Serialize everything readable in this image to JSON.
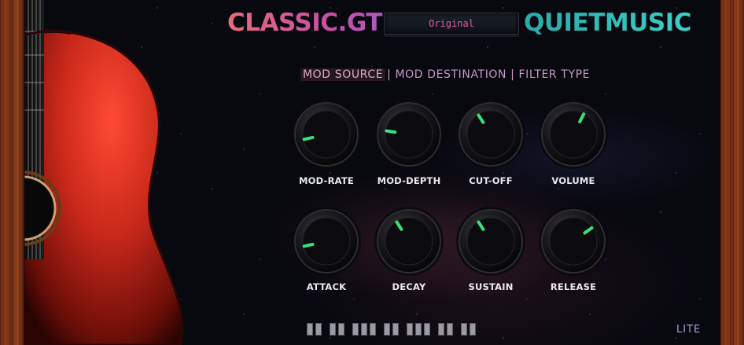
{
  "header": {
    "title_left": "CLASSIC.GTR",
    "preset_value": "Original",
    "title_right": "QUIETMUSIC"
  },
  "mod_tabs": [
    {
      "label": "MOD SOURCE",
      "active": true
    },
    {
      "label": "MOD DESTINATION",
      "active": false
    },
    {
      "label": "FILTER TYPE",
      "active": false
    }
  ],
  "mod_separator": "|",
  "knobs": [
    {
      "id": "mod-rate",
      "label": "MOD-RATE",
      "value": 0.12
    },
    {
      "id": "mod-depth",
      "label": "MOD-DEPTH",
      "value": 0.2
    },
    {
      "id": "cut-off",
      "label": "CUT-OFF",
      "value": 0.38
    },
    {
      "id": "volume",
      "label": "VOLUME",
      "value": 0.6
    },
    {
      "id": "attack",
      "label": "ATTACK",
      "value": 0.12
    },
    {
      "id": "decay",
      "label": "DECAY",
      "value": 0.38
    },
    {
      "id": "sustain",
      "label": "SUSTAIN",
      "value": 0.38
    },
    {
      "id": "release",
      "label": "RELEASE",
      "value": 0.7
    }
  ],
  "step_groups": [
    2,
    2,
    3,
    2,
    3,
    2,
    2
  ],
  "badge": "LITE",
  "colors": {
    "indicator": "#3be07a",
    "title_left": "#d45a9c",
    "title_right": "#35c4bd",
    "preset_text": "#e05aa0",
    "tab_text": "#c898c8",
    "badge": "#a3a3d6"
  }
}
